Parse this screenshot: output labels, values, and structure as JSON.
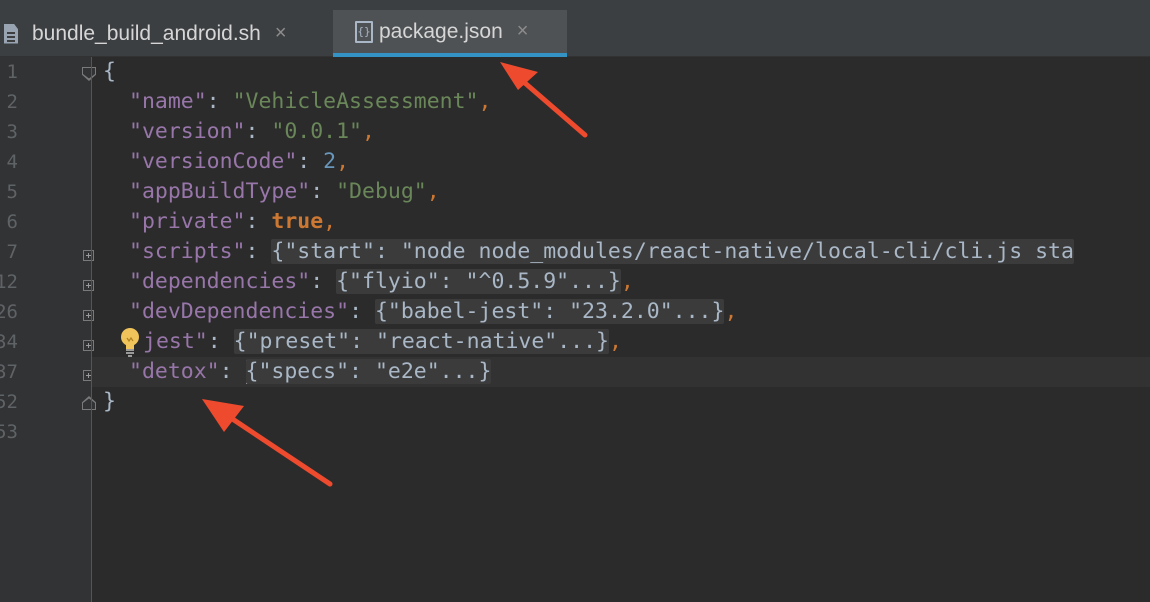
{
  "tabs": [
    {
      "label": "bundle_build_android.sh",
      "icon": "shell-file-icon",
      "active": false,
      "close": "×"
    },
    {
      "label": "package.json",
      "icon": "json-file-icon",
      "active": true,
      "close": "×"
    }
  ],
  "gutter": {
    "line_numbers": [
      "1",
      "2",
      "3",
      "4",
      "5",
      "6",
      "7",
      "12",
      "26",
      "34",
      "37",
      "52",
      "53"
    ]
  },
  "editor": {
    "open_brace": "{",
    "close_brace": "}",
    "entries": [
      {
        "key": "\"name\"",
        "value": "\"VehicleAssessment\"",
        "type": "string",
        "comma": ","
      },
      {
        "key": "\"version\"",
        "value": "\"0.0.1\"",
        "type": "string",
        "comma": ","
      },
      {
        "key": "\"versionCode\"",
        "value": "2",
        "type": "number",
        "comma": ","
      },
      {
        "key": "\"appBuildType\"",
        "value": "\"Debug\"",
        "type": "string",
        "comma": ","
      },
      {
        "key": "\"private\"",
        "value": "true",
        "type": "boolean",
        "comma": ","
      },
      {
        "key": "\"scripts\"",
        "value": "{\"start\": \"node node_modules/react-native/local-cli/cli.js sta",
        "type": "folded",
        "comma": ""
      },
      {
        "key": "\"dependencies\"",
        "value": "{\"flyio\": \"^0.5.9\"...}",
        "type": "folded",
        "comma": ","
      },
      {
        "key": "\"devDependencies\"",
        "value": "{\"babel-jest\": \"23.2.0\"...}",
        "type": "folded",
        "comma": ","
      },
      {
        "key": "jest\"",
        "value": "{\"preset\": \"react-native\"...}",
        "type": "folded",
        "comma": ","
      },
      {
        "key": "\"detox\"",
        "value": "{\"specs\": \"e2e\"...}",
        "type": "folded",
        "comma": ""
      }
    ],
    "separator": ": "
  },
  "colors": {
    "background": "#2b2b2b",
    "key": "#9876aa",
    "string": "#6a8759",
    "number": "#6897bb",
    "keyword": "#cc7832",
    "annotation_arrow": "#ee4a2e",
    "active_tab_underline": "#3592c4"
  },
  "icons": {
    "intention": "lightbulb-icon",
    "close": "close-icon"
  }
}
